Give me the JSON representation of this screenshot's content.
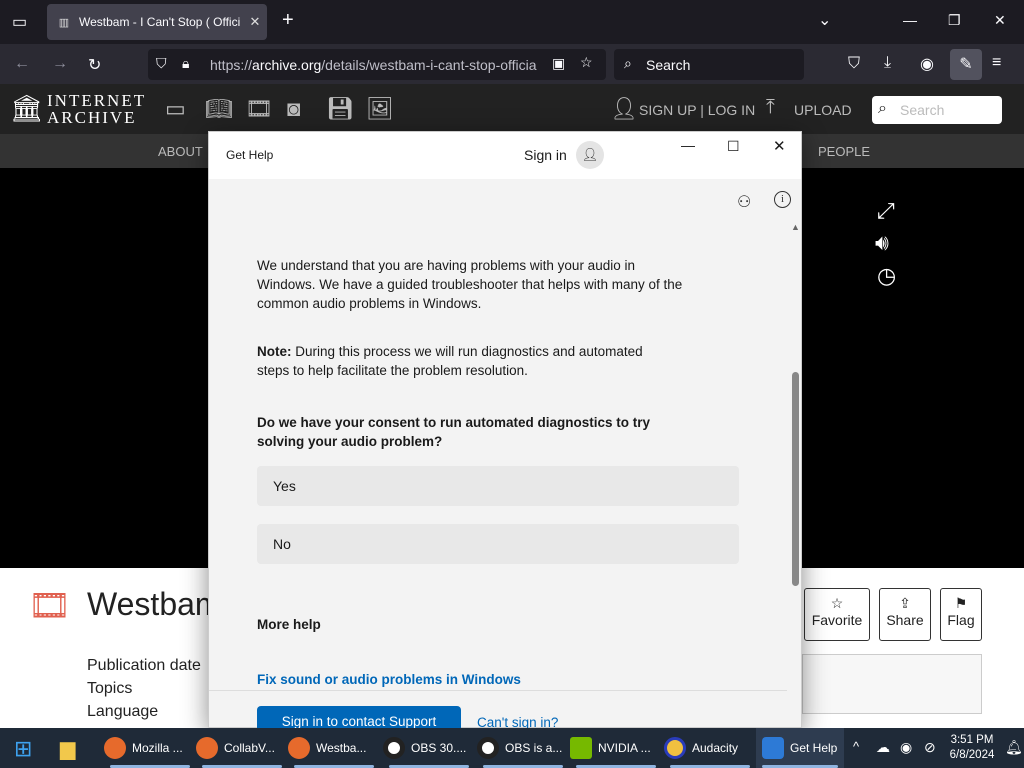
{
  "browser": {
    "tab_title": "Westbam - I Can't Stop ( Offici",
    "url_prefix": "https://",
    "url_domain": "archive.org",
    "url_path": "/details/westbam-i-cant-stop-officia",
    "search_placeholder": "Search"
  },
  "ia": {
    "logo_line1": "INTERNET",
    "logo_line2": "ARCHIVE",
    "signup": "SIGN UP | LOG IN",
    "upload": "UPLOAD",
    "search_placeholder": "Search",
    "nav_about": "ABOUT",
    "nav_people": "PEOPLE",
    "item_title": "Westbam",
    "meta": [
      "Publication date",
      "Topics",
      "Language"
    ],
    "actions": [
      "Favorite",
      "Share",
      "Flag"
    ]
  },
  "dialog": {
    "app_title": "Get Help",
    "sign_in": "Sign in",
    "para1": "We understand that you are having problems with your audio in Windows. We have a guided troubleshooter that helps with many of the common audio problems in Windows.",
    "note_label": "Note:",
    "note_text": " During this process we will run diagnostics and automated steps to help facilitate the problem resolution.",
    "question": "Do we have your consent to run automated diagnostics to try solving your audio problem?",
    "options": [
      "Yes",
      "No"
    ],
    "more_help": "More help",
    "fix_link": "Fix sound or audio problems in Windows",
    "contact_btn": "Sign in to contact Support",
    "cant_sign_in": "Can't sign in?"
  },
  "taskbar": {
    "items": [
      "Mozilla ...",
      "CollabV...",
      "Westba...",
      "OBS 30....",
      "OBS is a...",
      "NVIDIA ...",
      "Audacity",
      "Get Help"
    ],
    "time": "3:51 PM",
    "date": "6/8/2024"
  }
}
